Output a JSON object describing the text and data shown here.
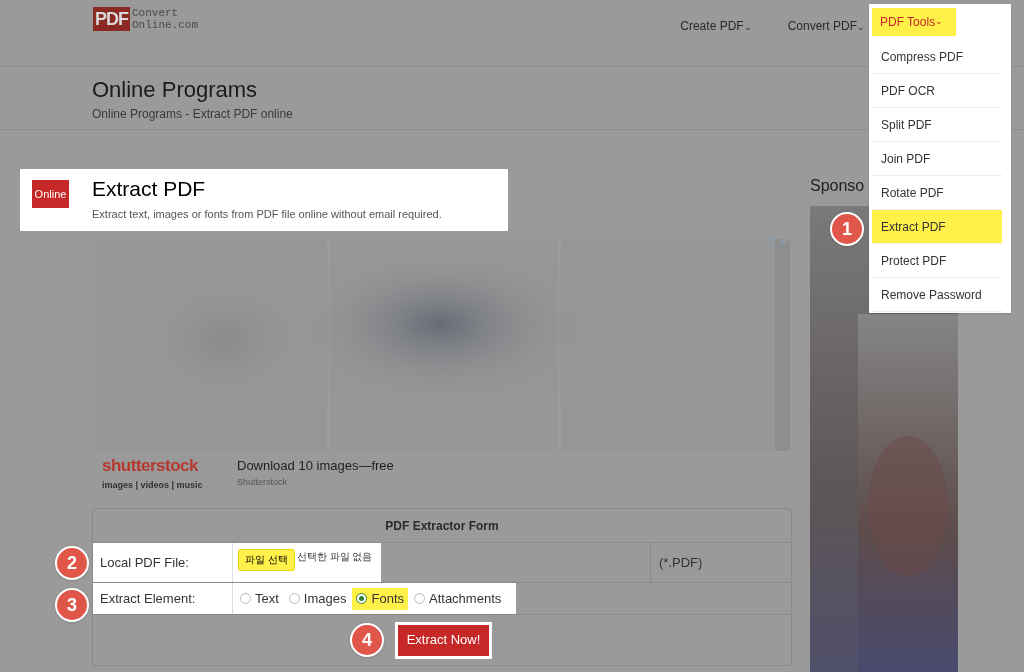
{
  "logo": {
    "mark": "PDF",
    "lines": [
      "Convert",
      "Online.com"
    ]
  },
  "nav": [
    {
      "label": "Create PDF",
      "caret": "⌄",
      "selected": false,
      "highlighted": false
    },
    {
      "label": "Convert PDF",
      "caret": "⌄",
      "selected": false,
      "highlighted": false
    },
    {
      "label": "PDF Tools",
      "caret": "⌄",
      "selected": true,
      "highlighted": true
    }
  ],
  "menu": [
    {
      "label": "Compress PDF",
      "highlighted": false
    },
    {
      "label": "PDF OCR",
      "highlighted": false
    },
    {
      "label": "Split PDF",
      "highlighted": false
    },
    {
      "label": "Join PDF",
      "highlighted": false
    },
    {
      "label": "Rotate PDF",
      "highlighted": false
    },
    {
      "label": "Extract PDF",
      "highlighted": true
    },
    {
      "label": "Protect PDF",
      "highlighted": false
    },
    {
      "label": "Remove Password",
      "highlighted": false
    }
  ],
  "page_header": {
    "title": "Online Programs",
    "subtitle": "Online Programs - Extract PDF online"
  },
  "tool": {
    "badge": "Online",
    "title": "Extract PDF",
    "description": "Extract text, images or fonts from PDF file online without email required."
  },
  "ad": {
    "brand": "shutterstock",
    "brand_tagline": "images | videos | music",
    "headline": "Download 10 images—free",
    "source": "Shutterstock"
  },
  "sidebar": {
    "title": "Sponso"
  },
  "form": {
    "title": "PDF Extractor Form",
    "file_row": {
      "label": "Local PDF File:",
      "button": "파일 선택",
      "button_highlighted": true,
      "status": "선택한 파일 없음",
      "hint": "(*.PDF)"
    },
    "element_row": {
      "label": "Extract Element:",
      "options": [
        {
          "label": "Text",
          "selected": false,
          "highlighted": false
        },
        {
          "label": "Images",
          "selected": false,
          "highlighted": false
        },
        {
          "label": "Fonts",
          "selected": true,
          "highlighted": true
        },
        {
          "label": "Attachments",
          "selected": false,
          "highlighted": false
        }
      ]
    },
    "submit": "Extract Now!"
  },
  "steps": [
    "1",
    "2",
    "3",
    "4"
  ]
}
